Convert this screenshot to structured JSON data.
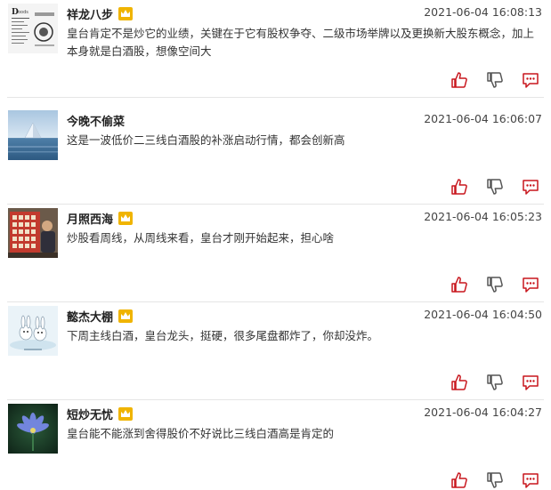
{
  "comments": [
    {
      "name": "祥龙八步",
      "vip": true,
      "time": "2021-06-04 16:08:13",
      "text": "皇台肯定不是炒它的业绩，关键在于它有股权争夺、二级市场举牌以及更换新大股东概念，加上本身就是白酒股，想像空间大",
      "avatar": "document-avatar"
    },
    {
      "name": "今晚不偷菜",
      "vip": false,
      "time": "2021-06-04 16:06:07",
      "text": "这是一波低价二三线白酒股的补涨启动行情，都会创新高",
      "avatar": "pyramid-sea-avatar"
    },
    {
      "name": "月照西海",
      "vip": true,
      "time": "2021-06-04 16:05:23",
      "text": "炒股看周线，从周线来看，皇台才刚开始起来，担心啥",
      "avatar": "person-chart-avatar"
    },
    {
      "name": "懿杰大棚",
      "vip": true,
      "time": "2021-06-04 16:04:50",
      "text": "下周主线白酒，皇台龙头，挺硬，很多尾盘都炸了，你却没炸。",
      "avatar": "cartoon-rabbits-avatar"
    },
    {
      "name": "短炒无忧",
      "vip": true,
      "time": "2021-06-04 16:04:27",
      "text": "皇台能不能涨到舍得股价不好说比三线白酒高是肯定的",
      "avatar": "lotus-flower-avatar"
    }
  ],
  "icons": {
    "vip": "crown-icon",
    "like": "thumbs-up-icon",
    "dislike": "thumbs-down-icon",
    "reply": "comment-bubble-icon"
  },
  "colors": {
    "action": "#c8161d",
    "vip": "#f0b400",
    "divider": "#e5e5e5"
  }
}
